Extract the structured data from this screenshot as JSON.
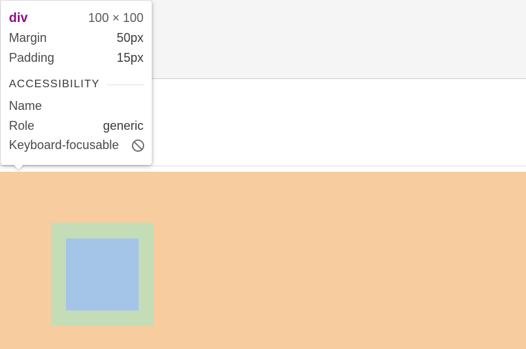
{
  "tooltip": {
    "element_tag": "div",
    "dimensions": "100 × 100",
    "rows": [
      {
        "label": "Margin",
        "value": "50px"
      },
      {
        "label": "Padding",
        "value": "15px"
      }
    ],
    "accessibility": {
      "heading": "ACCESSIBILITY",
      "name_label": "Name",
      "name_value": "",
      "role_label": "Role",
      "role_value": "generic",
      "keyboard_label": "Keyboard-focusable",
      "keyboard_icon": "not-allowed-icon"
    }
  },
  "colors": {
    "margin_overlay": "#f7cc9e",
    "padding_overlay": "#c4ddb7",
    "content_overlay": "#a5c5e8",
    "tag_name": "#881280"
  }
}
